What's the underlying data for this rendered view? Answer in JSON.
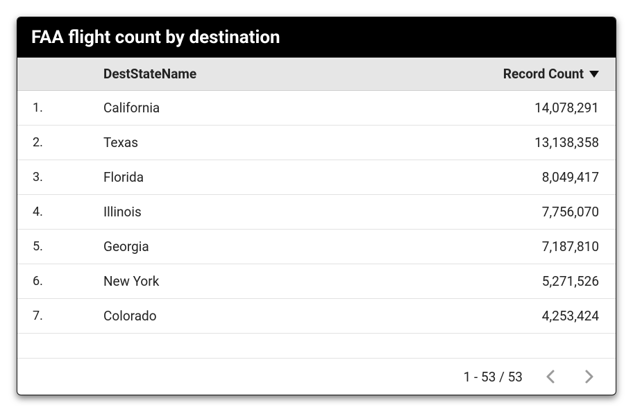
{
  "title": "FAA flight count by destination",
  "columns": {
    "state": "DestStateName",
    "count": "Record Count"
  },
  "rows": [
    {
      "index": "1.",
      "state": "California",
      "count": "14,078,291"
    },
    {
      "index": "2.",
      "state": "Texas",
      "count": "13,138,358"
    },
    {
      "index": "3.",
      "state": "Florida",
      "count": "8,049,417"
    },
    {
      "index": "4.",
      "state": "Illinois",
      "count": "7,756,070"
    },
    {
      "index": "5.",
      "state": "Georgia",
      "count": "7,187,810"
    },
    {
      "index": "6.",
      "state": "New York",
      "count": "5,271,526"
    },
    {
      "index": "7.",
      "state": "Colorado",
      "count": "4,253,424"
    }
  ],
  "pager": {
    "range": "1 - 53 / 53"
  },
  "chart_data": {
    "type": "table",
    "title": "FAA flight count by destination",
    "columns": [
      "DestStateName",
      "Record Count"
    ],
    "sort": {
      "column": "Record Count",
      "direction": "desc"
    },
    "total_rows": 53,
    "visible_rows": [
      {
        "DestStateName": "California",
        "Record Count": 14078291
      },
      {
        "DestStateName": "Texas",
        "Record Count": 13138358
      },
      {
        "DestStateName": "Florida",
        "Record Count": 8049417
      },
      {
        "DestStateName": "Illinois",
        "Record Count": 7756070
      },
      {
        "DestStateName": "Georgia",
        "Record Count": 7187810
      },
      {
        "DestStateName": "New York",
        "Record Count": 5271526
      },
      {
        "DestStateName": "Colorado",
        "Record Count": 4253424
      }
    ]
  }
}
